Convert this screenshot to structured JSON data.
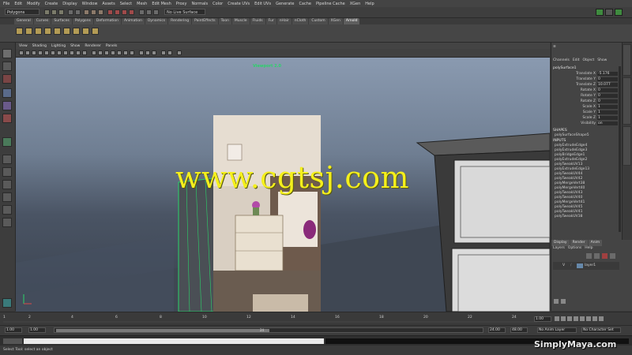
{
  "menu": [
    "File",
    "Edit",
    "Modify",
    "Create",
    "Display",
    "Window",
    "Assets",
    "Select",
    "Mesh",
    "Edit Mesh",
    "Proxy",
    "Normals",
    "Color",
    "Create UVs",
    "Edit UVs",
    "Generate",
    "Cache",
    "Pipeline Cache",
    "XGen",
    "Help"
  ],
  "status": {
    "mode": "Polygons",
    "render_box": "No Live Surface"
  },
  "shelf_tabs": [
    "General",
    "Curves",
    "Surfaces",
    "Polygons",
    "Deformation",
    "Animation",
    "Dynamics",
    "Rendering",
    "PaintEffects",
    "Toon",
    "Muscle",
    "Fluids",
    "Fur",
    "nHair",
    "nCloth",
    "Custom",
    "XGen",
    "Arnold"
  ],
  "shelf_active": "Arnold",
  "viewport_menu": [
    "View",
    "Shading",
    "Lighting",
    "Show",
    "Renderer",
    "Panels"
  ],
  "viewport_label": "Viewport 2.0",
  "watermark": "www.cgtsj.com",
  "brand": "SimplyMaya.com",
  "channel_box": {
    "tabs": [
      "Channels",
      "Edit",
      "Object",
      "Show"
    ],
    "object": "polySurface1",
    "attributes": [
      {
        "label": "Translate X",
        "value": "-5.176"
      },
      {
        "label": "Translate Y",
        "value": "0"
      },
      {
        "label": "Translate Z",
        "value": "10.077"
      },
      {
        "label": "Rotate X",
        "value": "0"
      },
      {
        "label": "Rotate Y",
        "value": "0"
      },
      {
        "label": "Rotate Z",
        "value": "0"
      },
      {
        "label": "Scale X",
        "value": "1"
      },
      {
        "label": "Scale Y",
        "value": "1"
      },
      {
        "label": "Scale Z",
        "value": "1"
      },
      {
        "label": "Visibility",
        "value": "on"
      }
    ],
    "shapes_header": "SHAPES",
    "shape_name": "polySurfaceShape5",
    "inputs_header": "INPUTS",
    "inputs": [
      "polyExtrudeEdge4",
      "polyExtrudeEdge3",
      "polyBridgeEdge1",
      "polyExtrudeEdge2",
      "polyTweakUV13",
      "polyExtrudeEdge13",
      "polyTweakUV44",
      "polyTweakUV42",
      "polyMergeVert38",
      "polyMergeVert40",
      "polyTweakUV43",
      "polyTweakUV40",
      "polyMergeVert41",
      "polyTweakUV45",
      "polyTweakUV41",
      "polyTweakUV38"
    ]
  },
  "layers": {
    "tabs": [
      "Display",
      "Render",
      "Anim"
    ],
    "menu": [
      "Layers",
      "Options",
      "Help"
    ],
    "row": {
      "flag": "V",
      "name": "layer1"
    }
  },
  "timeline": {
    "ticks": [
      "1",
      "2",
      "4",
      "6",
      "8",
      "10",
      "12",
      "14",
      "16",
      "18",
      "20",
      "22",
      "24"
    ],
    "current": "1.00",
    "range_start": "1.00",
    "range_start2": "1.00",
    "range_marker": "24",
    "range_end": "24.00",
    "range_end2": "48.00",
    "anim_layer": "No Anim Layer",
    "char_set": "No Character Set"
  },
  "help": "Select Tool: select an object"
}
